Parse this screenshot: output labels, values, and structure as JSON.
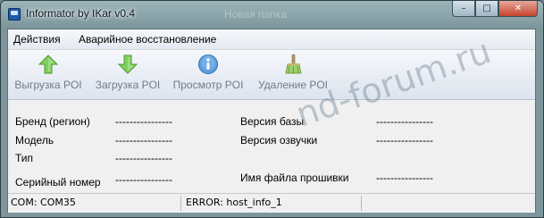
{
  "window": {
    "title": "Informator by IKar v0.4",
    "background_ghost_text": "Новая папка",
    "caption_buttons": {
      "minimize": "–",
      "maximize": "□",
      "close": "✕"
    }
  },
  "menu": {
    "items": [
      {
        "label": "Действия"
      },
      {
        "label": "Аварийное восстановление"
      }
    ]
  },
  "toolbar": {
    "buttons": [
      {
        "label": "Выгрузка POI",
        "icon": "arrow-up-icon"
      },
      {
        "label": "Загрузка POI",
        "icon": "arrow-down-icon"
      },
      {
        "label": "Просмотр POI",
        "icon": "info-icon"
      },
      {
        "label": "Удаление POI",
        "icon": "broom-icon"
      }
    ]
  },
  "info": {
    "left": [
      {
        "label": "Бренд (регион)",
        "value": "----------------"
      },
      {
        "label": "Модель",
        "value": "----------------"
      },
      {
        "label": "Тип",
        "value": "----------------"
      },
      {
        "label": "Серийный номер",
        "value": "----------------"
      }
    ],
    "right": [
      {
        "label": "Версия базы",
        "value": "----------------"
      },
      {
        "label": "Версия озвучки",
        "value": "----------------"
      },
      {
        "label": "Имя файла прошивки",
        "value": "----------------"
      }
    ]
  },
  "status": {
    "port": "COM: COM35",
    "error": "ERROR: host_info_1"
  },
  "watermark": "nd-forum.ru",
  "colors": {
    "arrow_green": "#6cc24a",
    "info_blue": "#3f88cf",
    "disabled_text": "#6f7c89",
    "title_glass": "#8aa7ae"
  }
}
